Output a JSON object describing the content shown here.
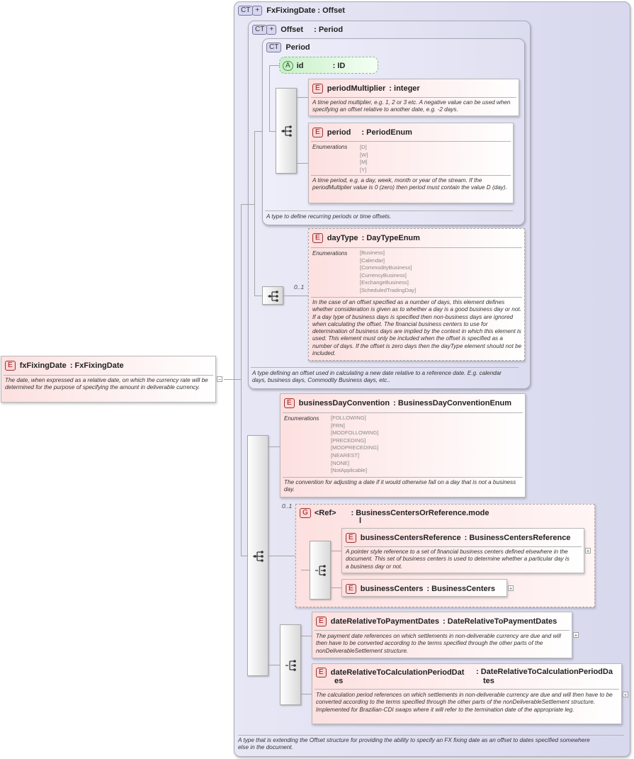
{
  "outer": {
    "badge": "CT",
    "name": "FxFixingDate",
    "type": ": Offset",
    "doc": "A type that is extending the Offset structure for providing the ability to specify an FX fixing date as an offset to dates specified somewhere else in the document."
  },
  "offset": {
    "badge": "CT",
    "name": "Offset",
    "type": ": Period",
    "doc": "A type defining an offset used in calculating a new date relative to a reference date. E.g. calendar days, business days, Commodity Business days, etc.."
  },
  "period_ct": {
    "badge": "CT",
    "name": "Period",
    "doc": "A type to define recurring periods or time offsets."
  },
  "attr_id": {
    "badge": "A",
    "name": "id",
    "type": ": ID"
  },
  "periodMultiplier": {
    "badge": "E",
    "name": "periodMultiplier",
    "type": ": integer",
    "doc": "A time period multiplier, e.g. 1, 2 or 3 etc. A negative value can be used when specifying an offset relative to another date, e.g. -2 days."
  },
  "period": {
    "badge": "E",
    "name": "period",
    "type": ": PeriodEnum",
    "enum_label": "Enumerations",
    "enums": [
      "[D]",
      "[W]",
      "[M]",
      "[Y]"
    ],
    "doc": "A time period, e.g. a day, week, month or year of the stream. If the periodMultiplier value is 0 (zero) then period must contain the value D (day)."
  },
  "dayType": {
    "badge": "E",
    "name": "dayType",
    "type": ": DayTypeEnum",
    "enum_label": "Enumerations",
    "enums": [
      "[Business]",
      "[Calendar]",
      "[CommodityBusiness]",
      "[CurrencyBusiness]",
      "[ExchangeBusiness]",
      "[ScheduledTradingDay]"
    ],
    "occ": "0..1",
    "doc": "In the case of an offset specified as a number of days, this element defines whether consideration is given as to whether a day is a good business day or not. If a day type of business days is specified then non-business days are ignored when calculating the offset. The financial business centers to use for determination of business days are implied by the context in which this element is used. This element must only be included when the offset is specified as a number of days. If the offset is zero days then the dayType element should not be included."
  },
  "fxFixingDate": {
    "badge": "E",
    "name": "fxFixingDate",
    "type": ": FxFixingDate",
    "doc": "The date, when expressed as a relative date, on which the currency rate will be determined for the purpose of specifying the amount in deliverable currency.",
    "collapse": "−"
  },
  "bdc": {
    "badge": "E",
    "name": "businessDayConvention",
    "type": ": BusinessDayConventionEnum",
    "enum_label": "Enumerations",
    "enums": [
      "[FOLLOWING]",
      "[FRN]",
      "[MODFOLLOWING]",
      "[PRECEDING]",
      "[MODPRECEDING]",
      "[NEAREST]",
      "[NONE]",
      "[NotApplicable]"
    ],
    "doc": "The convention for adjusting a date if it would otherwise fall on a day that is not a business day."
  },
  "group": {
    "badge": "G",
    "name": "<Ref>",
    "type_line1": ": BusinessCentersOrReference.mode",
    "type_line2": "l",
    "occ": "0..1"
  },
  "bcRef": {
    "badge": "E",
    "name": "businessCentersReference",
    "type": ": BusinessCentersReference",
    "doc": "A pointer style reference to a set of financial business centers defined elsewhere in the document. This set of business centers is used to determine whether a particular day is a business day or not."
  },
  "bc": {
    "badge": "E",
    "name": "businessCenters",
    "type": ": BusinessCenters"
  },
  "drtpd": {
    "badge": "E",
    "name": "dateRelativeToPaymentDates",
    "type": ": DateRelativeToPaymentDates",
    "doc": "The payment date references on which settlements in non-deliverable currency are due and will then have to be converted according to the terms specified through the other parts of the nonDeliverableSettlement structure."
  },
  "drtcpd": {
    "badge": "E",
    "name_line1": "dateRelativeToCalculationPeriodDat",
    "name_line2": "es",
    "type_line1": ": DateRelativeToCalculationPeriodDa",
    "type_line2": "tes",
    "doc": "The calculation period references on which settlements in non-deliverable currency are due and will then have to be converted according to the terms specified through the other parts of the nonDeliverableSettlement structure. Implemented for Brazilian-CDI swaps where it will refer to the termination date of the appropriate leg."
  },
  "expand": "+",
  "icons": [
    "sequence-icon",
    "choice-icon",
    "expand-icon",
    "collapse-icon",
    "complex-type-icon"
  ]
}
